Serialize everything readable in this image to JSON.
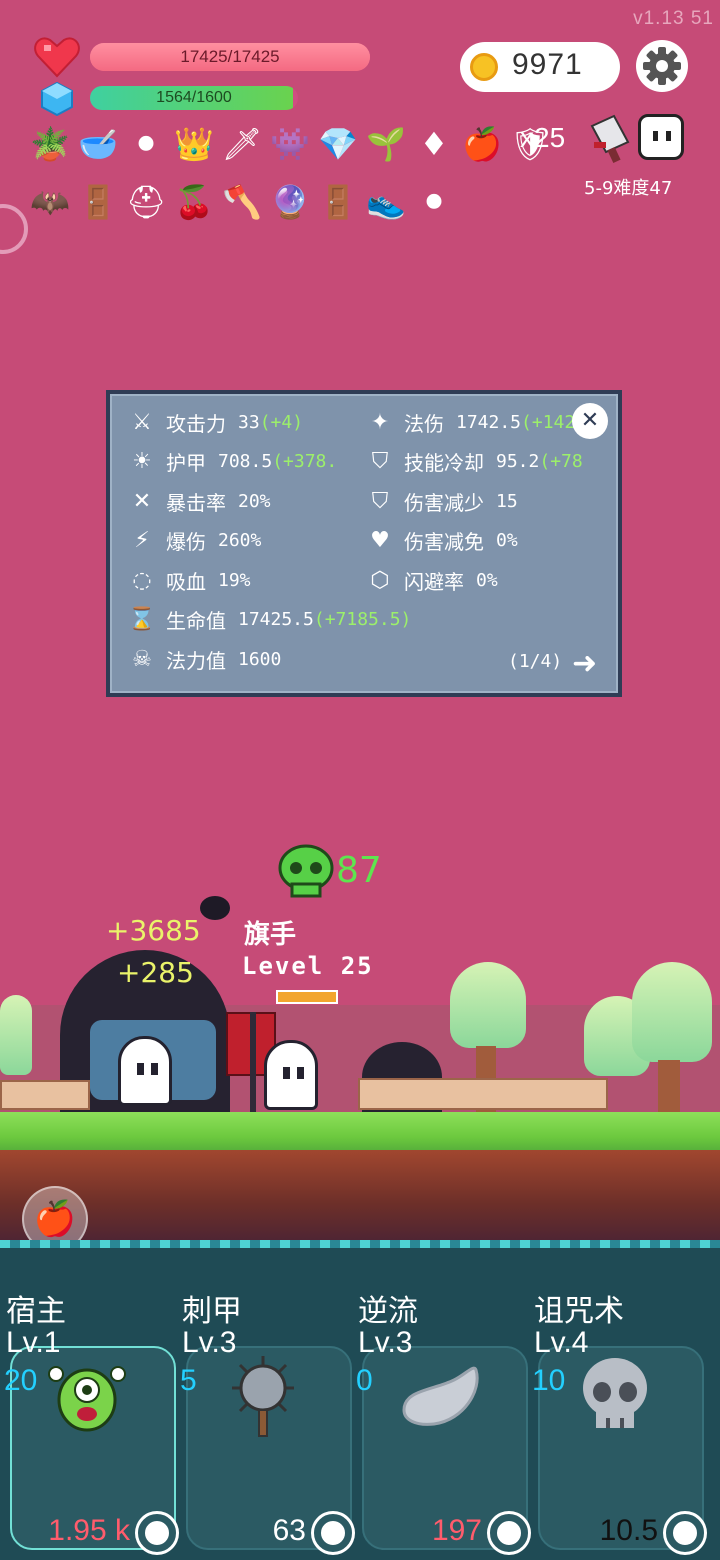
{
  "version": "v1.13   51",
  "hud": {
    "hp_text": "17425/17425",
    "hp_fraction": 1.0,
    "mp_text": "1564/1600",
    "mp_fraction": 0.9775,
    "coins": "9971",
    "item_multiplier": "x25",
    "stage": "5-9难度47"
  },
  "items_row1": [
    "potted-plant-icon",
    "mortar-icon",
    "cauldron-icon",
    "crown-icon",
    "sword-icon",
    "green-monster-icon",
    "diamond-icon",
    "sapling-icon",
    "ruby-icon",
    "apple-icon",
    "shield-icon"
  ],
  "items_row2": [
    "bat-icon",
    "tombstone-icon",
    "viking-helmet-icon",
    "cherry-icon",
    "axe-icon",
    "crystal-ball-icon",
    "tombstone-icon",
    "sneaker-icon",
    "cauldron-icon"
  ],
  "stats": {
    "attack": {
      "label": "攻击力",
      "value": "33",
      "bonus": "(+4)"
    },
    "armor": {
      "label": "护甲",
      "value": "708.5",
      "bonus": "(+378."
    },
    "crit_rate": {
      "label": "暴击率",
      "value": "20%"
    },
    "crit_damage": {
      "label": "爆伤",
      "value": "260%"
    },
    "lifesteal": {
      "label": "吸血",
      "value": "19%"
    },
    "health": {
      "label": "生命值",
      "value": "17425.5",
      "bonus": "(+7185.5)"
    },
    "mana": {
      "label": "法力值",
      "value": "1600"
    },
    "magic_damage": {
      "label": "法伤",
      "value": "1742.5",
      "bonus": "(+142"
    },
    "cooldown": {
      "label": "技能冷却",
      "value": "95.2",
      "bonus": "(+78"
    },
    "damage_reduce": {
      "label": "伤害减少",
      "value": "15"
    },
    "damage_immune": {
      "label": "伤害减免",
      "value": "0%"
    },
    "dodge": {
      "label": "闪避率",
      "value": "0%"
    },
    "page": "(1/4)"
  },
  "battle": {
    "damage_text_1": "+3685",
    "damage_text_2": "+285",
    "poison_damage": "87",
    "enemy_name": "旗手",
    "enemy_level": "Level 25",
    "enemy_hp_fraction": 1.0
  },
  "skills": [
    {
      "name": "宿主",
      "level": "Lv.1",
      "count": "20",
      "cost": "1.95 k",
      "cost_color": "#ff5c6c",
      "icon": "green-eyeball-monster-icon"
    },
    {
      "name": "刺甲",
      "level": "Lv.3",
      "count": "5",
      "cost": "63",
      "cost_color": "#ffffff",
      "icon": "spiked-mace-icon"
    },
    {
      "name": "逆流",
      "level": "Lv.3",
      "count": "0",
      "cost": "197",
      "cost_color": "#ff5c6c",
      "icon": "wisp-icon"
    },
    {
      "name": "诅咒术",
      "level": "Lv.4",
      "count": "10",
      "cost": "10.5",
      "cost_color": "#111111",
      "icon": "skull-icon"
    }
  ]
}
